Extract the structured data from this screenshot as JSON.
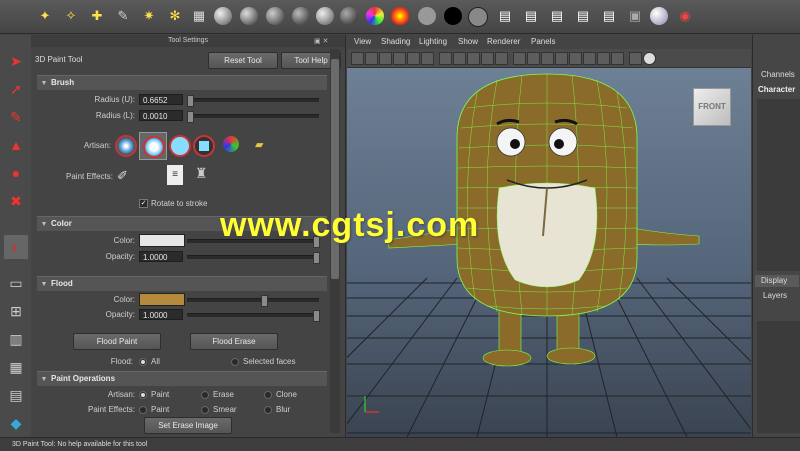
{
  "tool_settings": {
    "panel_title": "Tool Settings",
    "tool_name": "3D Paint Tool",
    "reset_label": "Reset Tool",
    "help_label": "Tool Help"
  },
  "brush": {
    "header": "Brush",
    "radius_u_label": "Radius (U):",
    "radius_u_value": "0.6652",
    "radius_l_label": "Radius (L):",
    "radius_l_value": "0.0010",
    "artisan_label": "Artisan:",
    "paint_effects_label": "Paint Effects:",
    "rotate_label": "Rotate to stroke",
    "rotate_checked": true
  },
  "color": {
    "header": "Color",
    "color_label": "Color:",
    "color_swatch": "#e6e6e6",
    "opacity_label": "Opacity:",
    "opacity_value": "1.0000",
    "opacity": 1.0
  },
  "flood": {
    "header": "Flood",
    "color_label": "Color:",
    "color_swatch": "#b58a3c",
    "opacity_label": "Opacity:",
    "opacity_value": "1.0000",
    "flood_paint_label": "Flood Paint",
    "flood_erase_label": "Flood Erase",
    "flood_label": "Flood:",
    "opt_all": "All",
    "opt_selected": "Selected faces"
  },
  "paint_operations": {
    "header": "Paint Operations",
    "artisan_label": "Artisan:",
    "artisan_paint": "Paint",
    "artisan_erase": "Erase",
    "artisan_clone": "Clone",
    "effects_label": "Paint Effects:",
    "effects_paint": "Paint",
    "effects_smear": "Smear",
    "effects_blur": "Blur",
    "set_erase_label": "Set Erase Image"
  },
  "viewport": {
    "menu": [
      "View",
      "Shading",
      "Lighting",
      "Show",
      "Renderer",
      "Panels"
    ],
    "view_cube_label": "FRONT"
  },
  "channel_box": {
    "tab_channels": "Channels",
    "character_label": "Character",
    "tab_display": "Display",
    "layers_label": "Layers"
  },
  "status_bar": {
    "text": "3D Paint Tool: No help available for this tool"
  },
  "watermark": "www.cgtsj.com",
  "colors": {
    "character_body": "#8a6b2a",
    "wireframe": "#7cff4a"
  }
}
